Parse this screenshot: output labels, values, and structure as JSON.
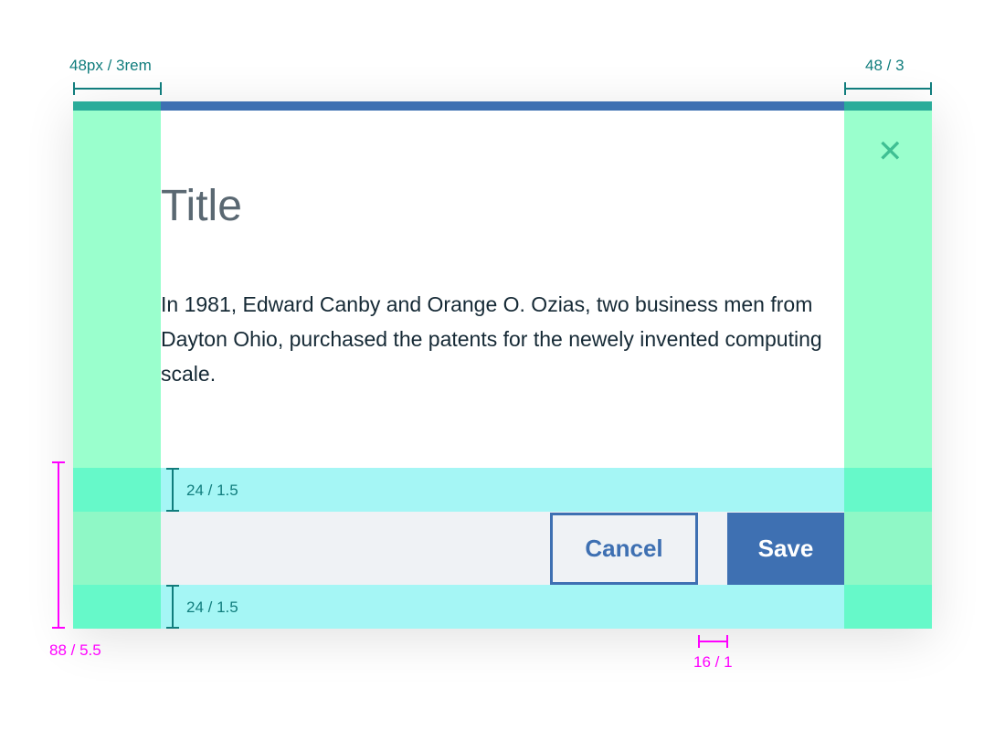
{
  "modal": {
    "title": "Title",
    "body": "In 1981, Edward Canby and Orange O. Ozias, two business men from Dayton Ohio, purchased the patents for the newely invented computing scale.",
    "close_icon": "close-icon",
    "cancel_label": "Cancel",
    "save_label": "Save"
  },
  "annotations": {
    "left_padding": "48px / 3rem",
    "right_padding": "48 / 3",
    "footer_top_padding": "24 / 1.5",
    "footer_bottom_padding": "24 / 1.5",
    "footer_height": "88 / 5.5",
    "button_gap": "16 / 1"
  },
  "colors": {
    "primary": "#3e70b2",
    "annotation_teal": "#117d7d",
    "annotation_magenta": "#ff00ff"
  }
}
